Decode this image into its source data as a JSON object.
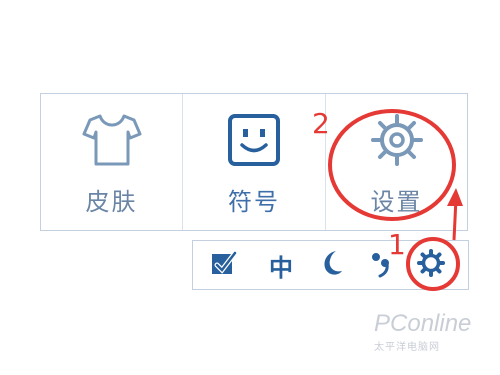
{
  "menu": {
    "items": [
      {
        "label": "皮肤",
        "icon": "tshirt-icon"
      },
      {
        "label": "符号",
        "icon": "smiley-icon"
      },
      {
        "label": "设置",
        "icon": "gear-icon"
      }
    ]
  },
  "toolbar": {
    "mode_label": "中",
    "icons": [
      "checkbox-brush-icon",
      "mode-text",
      "moon-icon",
      "punctuation-icon",
      "gear-icon"
    ]
  },
  "annotations": {
    "step1": "1",
    "step2": "2",
    "color": "#e53935"
  },
  "watermark": {
    "brand": "PConline",
    "sub": "太平洋电脑网"
  },
  "colors": {
    "icon_light": "#7a98b8",
    "icon_dark": "#27609c",
    "border": "#c3d0e0"
  }
}
